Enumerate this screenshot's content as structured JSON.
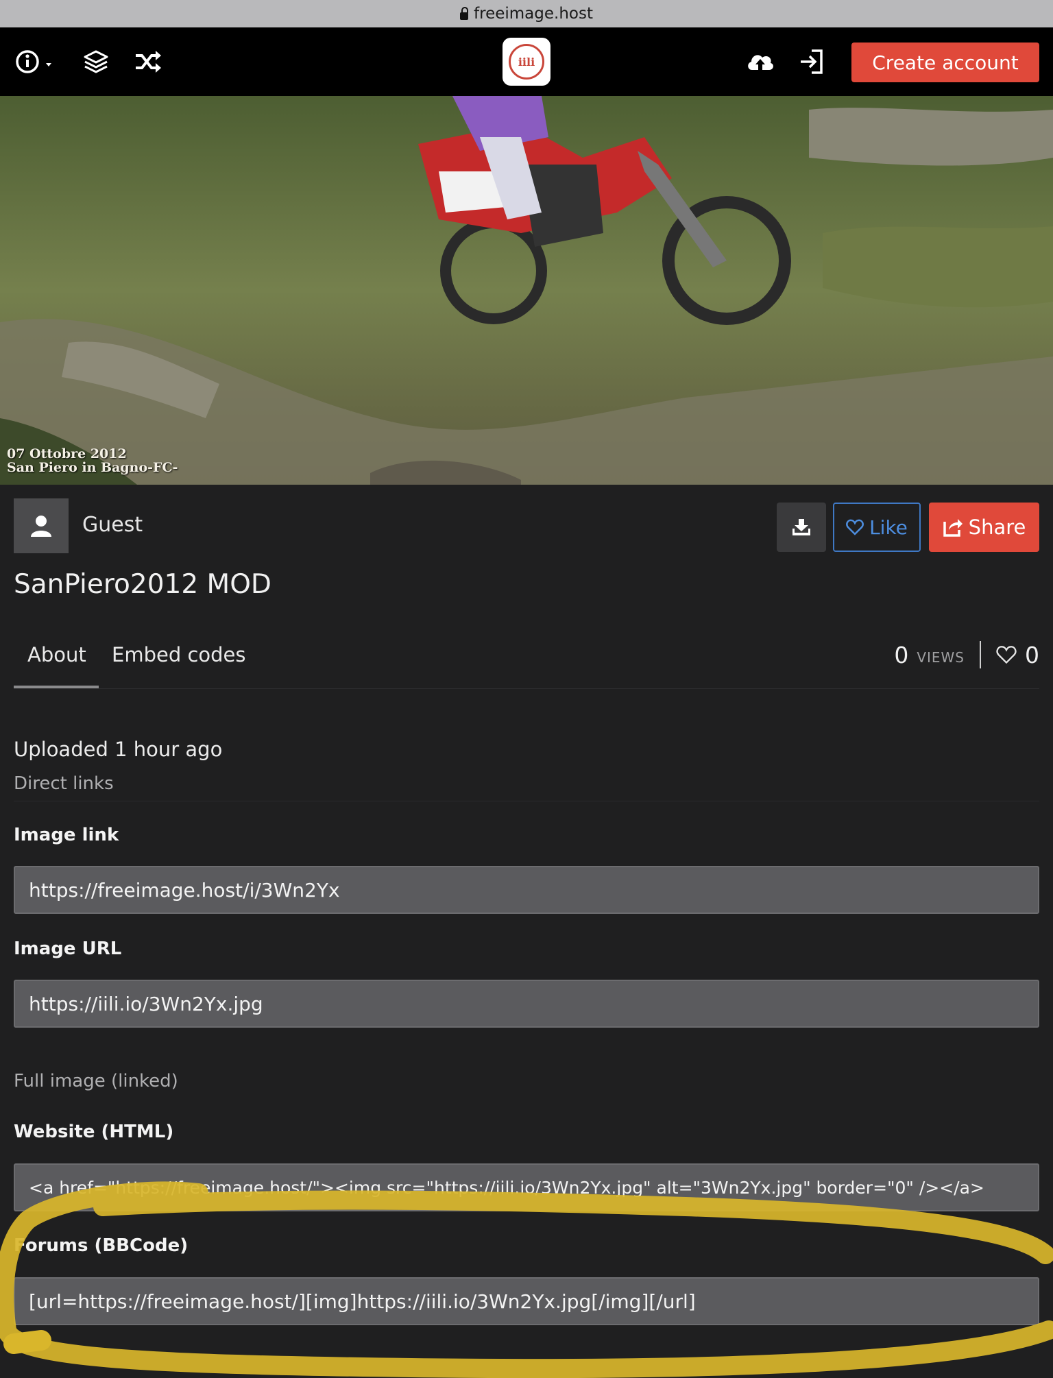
{
  "browser": {
    "url": "freeimage.host"
  },
  "nav": {
    "create_account": "Create account",
    "logo_text": "iili"
  },
  "hero": {
    "caption_line1": "07 Ottobre 2012",
    "caption_line2": "San Piero in Bagno-FC-"
  },
  "author": {
    "name": "Guest"
  },
  "actions": {
    "like": "Like",
    "share": "Share"
  },
  "image": {
    "title": "SanPiero2012 MOD"
  },
  "tabs": [
    {
      "label": "About"
    },
    {
      "label": "Embed codes"
    }
  ],
  "stats": {
    "views": "0",
    "views_label": "VIEWS",
    "likes": "0"
  },
  "about": {
    "uploaded": "Uploaded 1 hour ago",
    "direct_links_heading": "Direct links",
    "full_image_heading": "Full image (linked)"
  },
  "fields": {
    "image_link": {
      "label": "Image link",
      "value": "https://freeimage.host/i/3Wn2Yx"
    },
    "image_url": {
      "label": "Image URL",
      "value": "https://iili.io/3Wn2Yx.jpg"
    },
    "html": {
      "label": "Website (HTML)",
      "value": "<a href=\"https://freeimage.host/\"><img src=\"https://iili.io/3Wn2Yx.jpg\" alt=\"3Wn2Yx.jpg\" border=\"0\" /></a>"
    },
    "bbcode": {
      "label": "Forums (BBCode)",
      "value": "[url=https://freeimage.host/][img]https://iili.io/3Wn2Yx.jpg[/img][/url]"
    }
  },
  "colors": {
    "accent": "#e0493a",
    "like_blue": "#3f78c4",
    "highlight": "#d9b62b"
  }
}
